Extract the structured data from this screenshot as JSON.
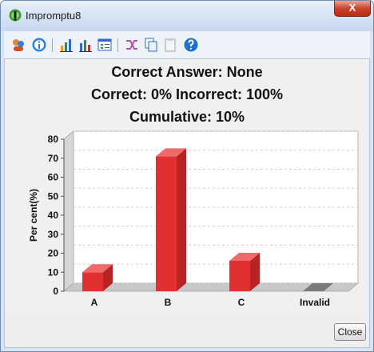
{
  "window": {
    "title": "Impromptu8",
    "close_glyph": "X"
  },
  "toolbar": {
    "buttons": [
      "users-icon",
      "info-icon",
      "bar-chart-icon",
      "column-chart-icon",
      "form-icon",
      "shuffle-icon",
      "copy-icon",
      "clipboard-icon",
      "help-icon"
    ]
  },
  "summary": {
    "line1": "Correct Answer: None",
    "line2": "Correct: 0%  Incorrect: 100%",
    "line3": "Cumulative: 10%"
  },
  "chart_data": {
    "type": "bar",
    "categories": [
      "A",
      "B",
      "C",
      "Invalid"
    ],
    "values": [
      10,
      71,
      16,
      0
    ],
    "ylabel": "Per cent(%)",
    "ylim": [
      0,
      80
    ],
    "yticks": [
      "0",
      "10",
      "20",
      "30",
      "40",
      "50",
      "60",
      "70",
      "80"
    ],
    "bar_color": "#e03030",
    "zero_bar_color": "#7a7a7a",
    "grid": true
  },
  "footer": {
    "close_label": "Close"
  }
}
